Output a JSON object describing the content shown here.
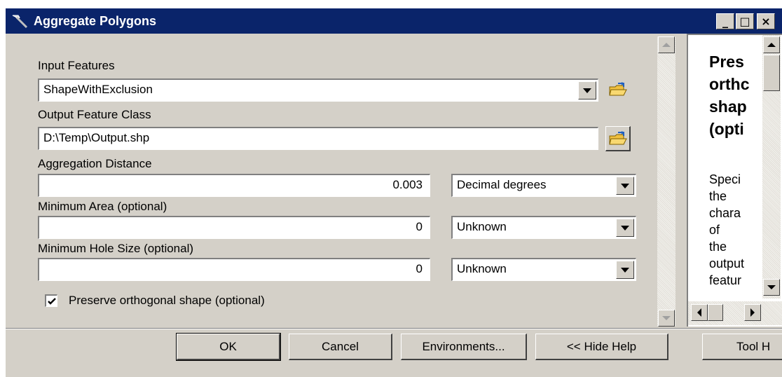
{
  "window": {
    "title": "Aggregate Polygons",
    "controls": {
      "minimize": "_",
      "maximize": "□",
      "close": "×"
    }
  },
  "form": {
    "input_features": {
      "label": "Input Features",
      "value": "ShapeWithExclusion"
    },
    "output_feature_class": {
      "label": "Output Feature Class",
      "value": "D:\\Temp\\Output.shp"
    },
    "aggregation_distance": {
      "label": "Aggregation Distance",
      "value": "0.003",
      "unit": "Decimal degrees"
    },
    "minimum_area": {
      "label": "Minimum Area (optional)",
      "value": "0",
      "unit": "Unknown"
    },
    "minimum_hole_size": {
      "label": "Minimum Hole Size (optional)",
      "value": "0",
      "unit": "Unknown"
    },
    "preserve_orthogonal": {
      "label": "Preserve orthogonal shape (optional)",
      "checked": true
    }
  },
  "help": {
    "title_lines": [
      "Pres",
      "orthc",
      "shap",
      "(opti"
    ],
    "body_lines": [
      "Speci",
      "the",
      "chara",
      "of",
      "the",
      "output",
      "featur"
    ]
  },
  "buttons": {
    "ok": "OK",
    "cancel": "Cancel",
    "environments": "Environments...",
    "hide_help": "<< Hide Help",
    "tool_help": "Tool H"
  }
}
